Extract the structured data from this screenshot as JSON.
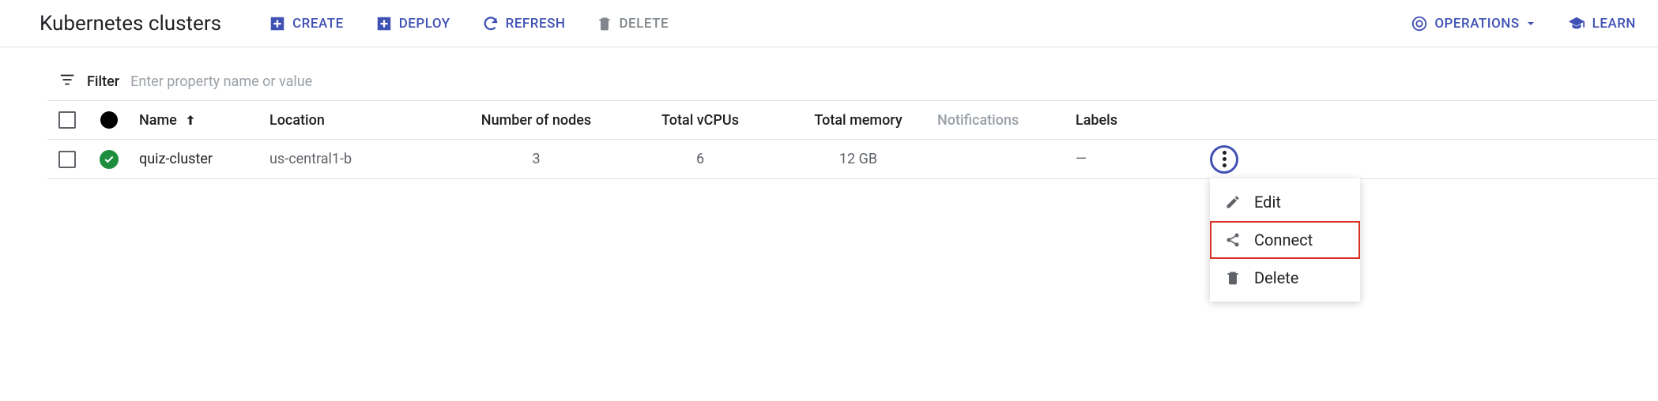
{
  "header": {
    "title": "Kubernetes clusters",
    "actions": {
      "create": "CREATE",
      "deploy": "DEPLOY",
      "refresh": "REFRESH",
      "delete": "DELETE",
      "operations": "OPERATIONS",
      "learn": "LEARN"
    }
  },
  "filter": {
    "label": "Filter",
    "placeholder": "Enter property name or value"
  },
  "table": {
    "columns": {
      "name": "Name",
      "location": "Location",
      "nodes": "Number of nodes",
      "vcpus": "Total vCPUs",
      "memory": "Total memory",
      "notifications": "Notifications",
      "labels": "Labels"
    },
    "rows": [
      {
        "name": "quiz-cluster",
        "location": "us-central1-b",
        "nodes": "3",
        "vcpus": "6",
        "memory": "12 GB",
        "notifications": "",
        "labels": "—"
      }
    ]
  },
  "context_menu": {
    "edit": "Edit",
    "connect": "Connect",
    "delete": "Delete"
  }
}
